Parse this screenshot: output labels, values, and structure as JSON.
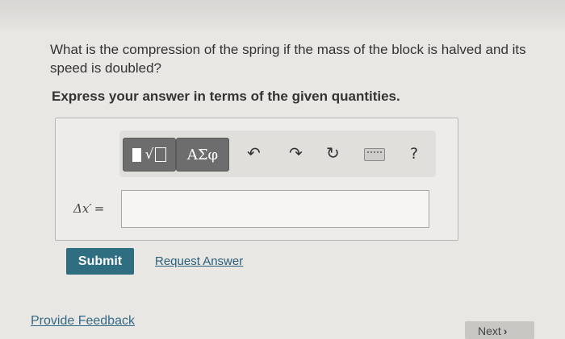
{
  "question": {
    "text": "What is the compression of the spring if the mass of the block is halved and its speed is doubled?",
    "instruction": "Express your answer in terms of the given quantities."
  },
  "toolbar": {
    "greek_label": "ΑΣφ",
    "templates_root": "√",
    "undo_icon": "↶",
    "redo_icon": "↷",
    "reset_icon": "↻",
    "help_label": "?"
  },
  "answer": {
    "variable_label": "Δx′",
    "equals": "=",
    "value": ""
  },
  "actions": {
    "submit_label": "Submit",
    "request_label": "Request Answer"
  },
  "footer": {
    "feedback_label": "Provide Feedback",
    "next_label": "Next",
    "next_arrow": "›"
  }
}
